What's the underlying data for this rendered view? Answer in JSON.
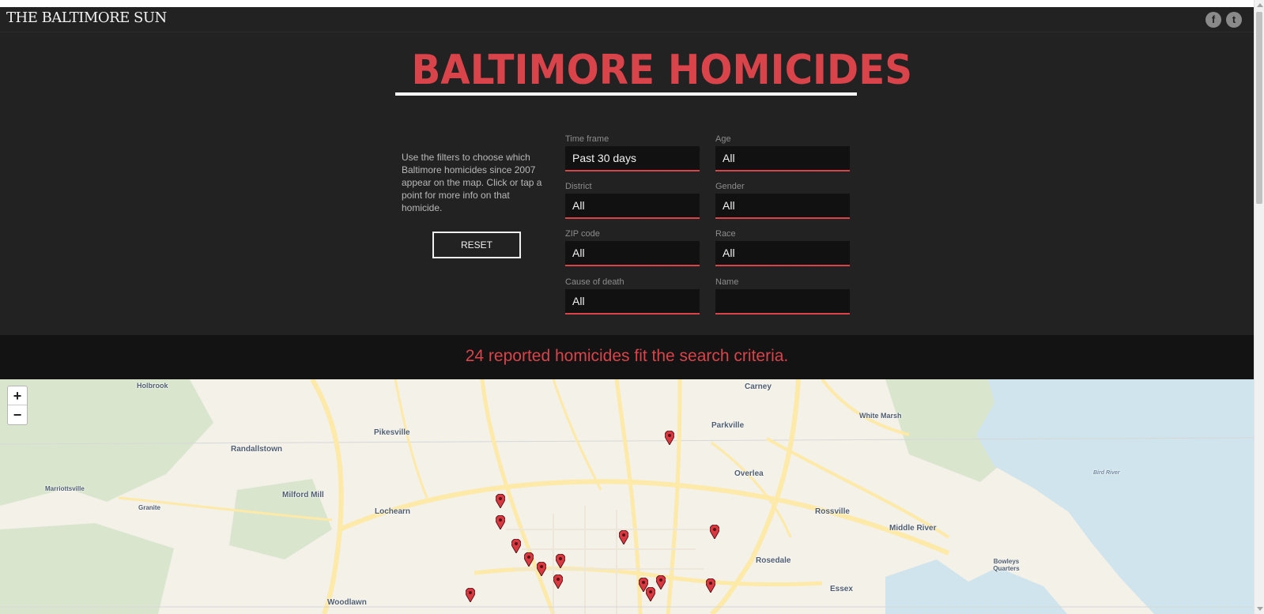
{
  "header": {
    "brand": "THE BALTIMORE SUN",
    "facebook_icon": "f",
    "twitter_icon": "t"
  },
  "hero": {
    "title": "BALTIMORE HOMICIDES",
    "intro": "Use the filters to choose which Baltimore homicides since 2007 appear on the map. Click or tap a point for more info on that homicide.",
    "reset_label": "RESET"
  },
  "filters": {
    "time_frame": {
      "label": "Time frame",
      "value": "Past 30 days"
    },
    "age": {
      "label": "Age",
      "value": "All"
    },
    "district": {
      "label": "District",
      "value": "All"
    },
    "gender": {
      "label": "Gender",
      "value": "All"
    },
    "zip_code": {
      "label": "ZIP code",
      "value": "All"
    },
    "race": {
      "label": "Race",
      "value": "All"
    },
    "cause_of_death": {
      "label": "Cause of death",
      "value": "All"
    },
    "name": {
      "label": "Name",
      "value": ""
    }
  },
  "result": {
    "text": "24 reported homicides fit the search criteria."
  },
  "map": {
    "zoom_in": "+",
    "zoom_out": "−",
    "places": {
      "holbrook": "Holbrook",
      "carney": "Carney",
      "white_marsh": "White Marsh",
      "pikesville": "Pikesville",
      "parkville": "Parkville",
      "randallstown": "Randallstown",
      "overlea": "Overlea",
      "marriottsville": "Marriottsville",
      "milford_mill": "Milford Mill",
      "granite": "Granite",
      "bird_river": "Bird River",
      "lochearn": "Lochearn",
      "rossville": "Rossville",
      "middle_river": "Middle River",
      "rosedale": "Rosedale",
      "bowleys_quarters": "Bowleys Quarters",
      "essex": "Essex",
      "woodlawn": "Woodlawn"
    },
    "colors": {
      "land": "#f3f1e8",
      "park": "#d9e6cd",
      "water": "#cfe4ec",
      "road": "#fde9a8",
      "marker": "#d8383f"
    }
  }
}
